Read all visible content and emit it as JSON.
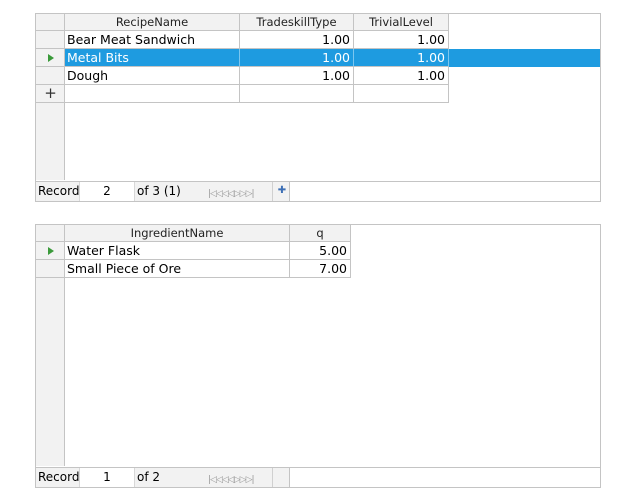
{
  "recipes": {
    "columns": [
      "RecipeName",
      "TradeskillType",
      "TrivialLevel"
    ],
    "rows": [
      {
        "name": "Bear Meat Sandwich",
        "type": "1.00",
        "level": "1.00"
      },
      {
        "name": "Metal Bits",
        "type": "1.00",
        "level": "1.00"
      },
      {
        "name": "Dough",
        "type": "1.00",
        "level": "1.00"
      }
    ],
    "selected_row": 2,
    "nav": {
      "record_label": "Record",
      "current": "2",
      "of_text": "of 3 (1)"
    }
  },
  "ingredients": {
    "columns": [
      "IngredientName",
      "q"
    ],
    "rows": [
      {
        "name": "Water Flask",
        "q": "5.00"
      },
      {
        "name": "Small Piece of Ore",
        "q": "7.00"
      }
    ],
    "current_row": 1,
    "nav": {
      "record_label": "Record",
      "current": "1",
      "of_text": "of 2"
    }
  },
  "icons": {
    "current_row": "green-triangle-icon",
    "new_row": "plus-icon",
    "nav": "record-navigation-arrows-icon",
    "new_record": "new-record-icon"
  },
  "colors": {
    "selection": "#1e9be0",
    "current_marker": "#3a9a3a"
  }
}
